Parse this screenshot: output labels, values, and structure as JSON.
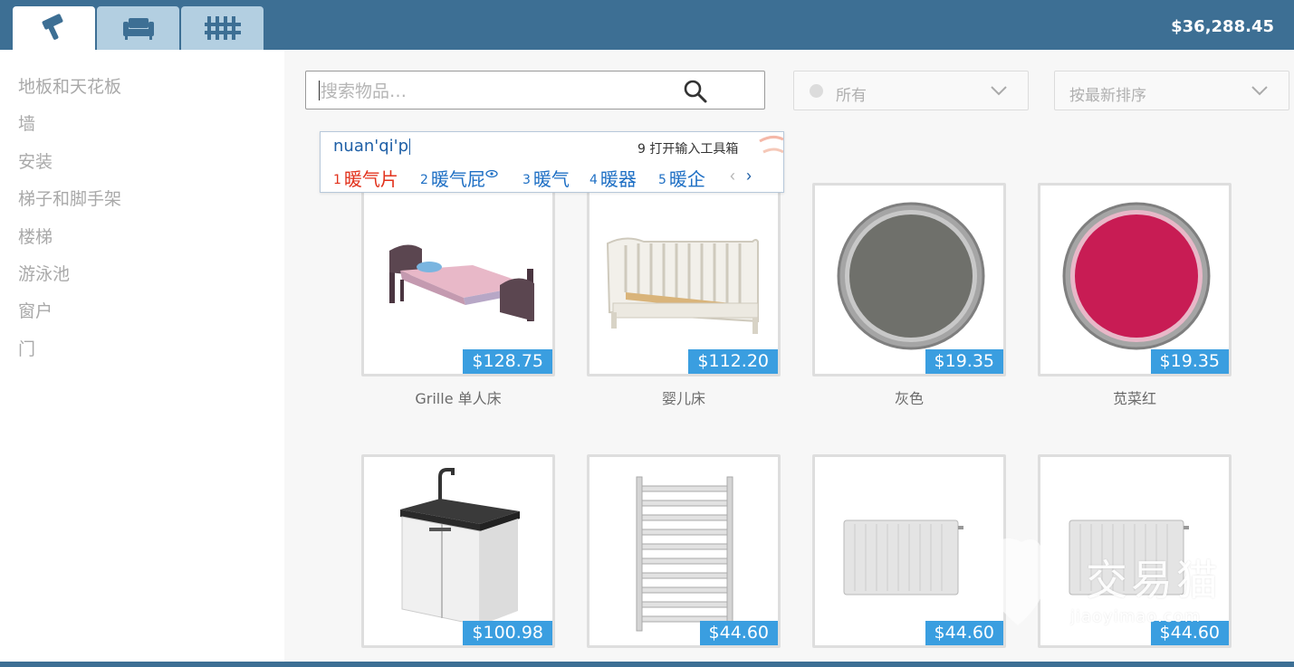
{
  "header": {
    "tabs": [
      {
        "name": "build",
        "icon": "paint-roller-icon"
      },
      {
        "name": "furniture",
        "icon": "sofa-icon"
      },
      {
        "name": "exterior",
        "icon": "fence-icon"
      }
    ],
    "balance": "$36,288.45"
  },
  "sidebar": {
    "items": [
      {
        "label": "地板和天花板"
      },
      {
        "label": "墙"
      },
      {
        "label": "安装"
      },
      {
        "label": "梯子和脚手架"
      },
      {
        "label": "楼梯"
      },
      {
        "label": "游泳池"
      },
      {
        "label": "窗户"
      },
      {
        "label": "门"
      }
    ]
  },
  "search": {
    "placeholder": "搜索物品…",
    "icon": "search-icon"
  },
  "filters": {
    "category_label": "所有",
    "sort_label": "按最新排序"
  },
  "ime": {
    "composition": "nuan'qi'p",
    "toolbox": "9 打开输入工具箱",
    "candidates": [
      {
        "num": "1",
        "text": "暖气片"
      },
      {
        "num": "2",
        "text": "暖气屁"
      },
      {
        "num": "3",
        "text": "暖气"
      },
      {
        "num": "4",
        "text": "暖器"
      },
      {
        "num": "5",
        "text": "暖企"
      }
    ],
    "prev": "‹",
    "next": "›"
  },
  "products": [
    {
      "name": "Grille 单人床",
      "price": "$128.75",
      "icon": "single-bed-icon"
    },
    {
      "name": "婴儿床",
      "price": "$112.20",
      "icon": "crib-icon"
    },
    {
      "name": "灰色",
      "price": "$19.35",
      "icon": "gray-round-rug-icon",
      "color": "#6f706b"
    },
    {
      "name": "苋菜红",
      "price": "$19.35",
      "icon": "amaranth-round-rug-icon",
      "color": "#c81c54"
    },
    {
      "name": "",
      "price": "$100.98",
      "icon": "sink-cabinet-icon"
    },
    {
      "name": "",
      "price": "$44.60",
      "icon": "towel-radiator-icon"
    },
    {
      "name": "",
      "price": "$44.60",
      "icon": "panel-radiator-icon"
    },
    {
      "name": "",
      "price": "$44.60",
      "icon": "panel-radiator-icon"
    }
  ],
  "watermark": {
    "text": "交易猫",
    "url": "jiaoyimao.com"
  }
}
